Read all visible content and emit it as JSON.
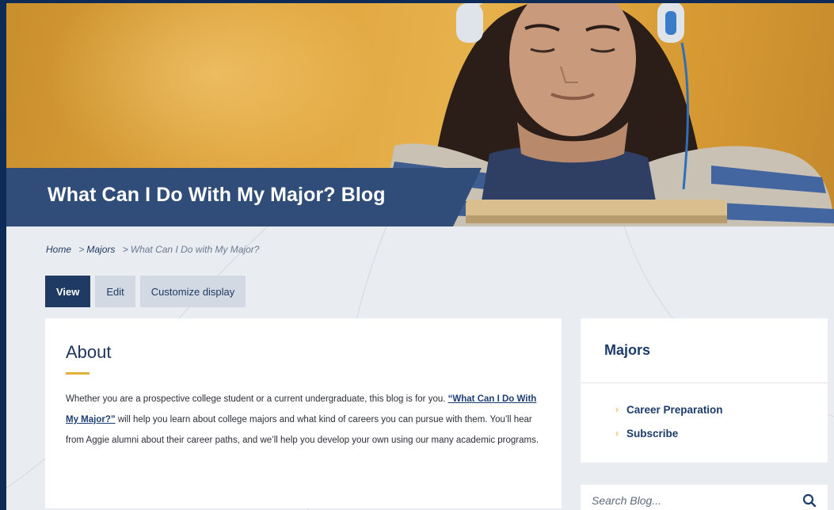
{
  "hero": {
    "title": "What Can I Do With My Major? Blog"
  },
  "breadcrumb": {
    "items": [
      "Home",
      "Majors"
    ],
    "current": "What Can I Do with My Major?",
    "separator": ">"
  },
  "tabs": [
    {
      "label": "View",
      "active": true
    },
    {
      "label": "Edit",
      "active": false
    },
    {
      "label": "Customize display",
      "active": false
    }
  ],
  "about": {
    "heading": "About",
    "text_before_link": "Whether you are a prospective college student or a current undergraduate, this blog is for you. ",
    "link_text": "“What Can I Do With My Major?”",
    "text_after_link": " will help you learn about college majors and what kind of careers you can pursue with them. You’ll hear from Aggie alumni about their career paths, and we’ll help you develop your own using our many academic programs."
  },
  "sidebar": {
    "heading": "Majors",
    "items": [
      {
        "label": "Career Preparation",
        "icon": "chevron-right-icon"
      },
      {
        "label": "Subscribe",
        "icon": "chevron-right-icon"
      }
    ]
  },
  "search": {
    "placeholder": "Search Blog...",
    "icon": "search-icon"
  },
  "colors": {
    "navy": "#1f3a63",
    "title_band": "#2f4d78",
    "accent_gold": "#e2b13c",
    "page_bg": "#e9ecf1",
    "outer_border": "#0e2a57"
  }
}
